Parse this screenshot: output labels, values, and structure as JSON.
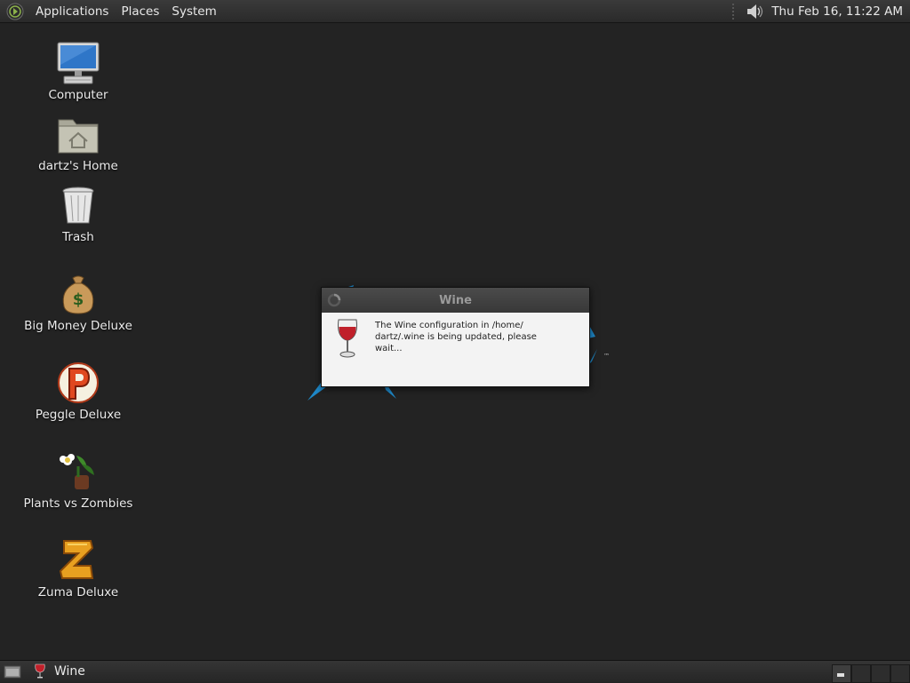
{
  "top_panel": {
    "menus": [
      "Applications",
      "Places",
      "System"
    ],
    "clock": "Thu Feb 16, 11:22 AM",
    "icons": {
      "menu": "distro-logo-icon",
      "volume": "volume-icon"
    }
  },
  "desktop": {
    "icons": [
      {
        "label": "Computer",
        "icon": "computer-icon"
      },
      {
        "label": "dartz's Home",
        "icon": "home-folder-icon"
      },
      {
        "label": "Trash",
        "icon": "trash-icon"
      },
      {
        "label": "Big Money Deluxe",
        "icon": "money-bag-icon"
      },
      {
        "label": "Peggle Deluxe",
        "icon": "peggle-icon"
      },
      {
        "label": "Plants vs Zombies",
        "icon": "plants-vs-zombies-icon"
      },
      {
        "label": "Zuma Deluxe",
        "icon": "zuma-icon"
      }
    ],
    "background_logo": {
      "trademark": "™"
    }
  },
  "dialog": {
    "title": "Wine",
    "message": "The Wine configuration in /home/ dartz/.wine is being updated, please wait...",
    "icons": {
      "spinner": "spinner-icon",
      "glass": "wine-glass-icon"
    }
  },
  "bottom_panel": {
    "task": {
      "label": "Wine",
      "icon": "wine-glass-icon"
    },
    "workspaces": 4,
    "active_workspace": 1
  },
  "colors": {
    "desktop_bg": "#232323",
    "dialog_bg": "#f3f3f3",
    "logo_blue": "#1e88c8",
    "wine_red": "#c0202a"
  }
}
